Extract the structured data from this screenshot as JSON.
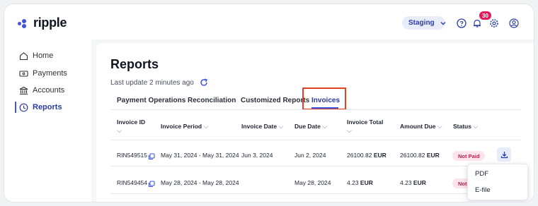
{
  "brand": {
    "name": "ripple",
    "accent": "#3f55e0"
  },
  "header": {
    "environment": "Staging",
    "notifications_count": "30",
    "icons": [
      "help-circle-icon",
      "bell-icon",
      "gear-icon",
      "user-icon"
    ]
  },
  "sidebar": {
    "items": [
      {
        "label": "Home",
        "icon": "home-icon"
      },
      {
        "label": "Payments",
        "icon": "payments-icon"
      },
      {
        "label": "Accounts",
        "icon": "bank-icon"
      },
      {
        "label": "Reports",
        "icon": "reports-icon",
        "active": true
      }
    ]
  },
  "page": {
    "title": "Reports",
    "last_update": "Last update 2 minutes ago"
  },
  "tabs": [
    {
      "label": "Payment Operations"
    },
    {
      "label": "Reconciliation"
    },
    {
      "label": "Customized Reports"
    },
    {
      "label": "Invoices",
      "active": true
    }
  ],
  "table": {
    "columns": [
      {
        "label": "Invoice ID"
      },
      {
        "label": "Invoice Period"
      },
      {
        "label": "Invoice Date"
      },
      {
        "label": "Due Date"
      },
      {
        "label": "Invoice Total"
      },
      {
        "label": "Amount Due"
      },
      {
        "label": "Status"
      }
    ],
    "sort_glyph": "⌵",
    "rows": [
      {
        "id": "RIN549515",
        "period": "May 31, 2024 - May 31, 2024",
        "invoice_date": "Jun 3, 2024",
        "due_date": "Jun 2, 2024",
        "total_amount": "26100.82",
        "total_currency": "EUR",
        "due_amount": "26100.82",
        "due_currency": "EUR",
        "status": "Not Paid"
      },
      {
        "id": "RIN549454",
        "period": "May 28, 2024 - May 28, 2024",
        "invoice_date": "",
        "due_date": "May 28, 2024",
        "total_amount": "4.23",
        "total_currency": "EUR",
        "due_amount": "4.23",
        "due_currency": "EUR",
        "status": "Not"
      }
    ]
  },
  "download_menu": {
    "options": [
      "PDF",
      "E-file"
    ]
  },
  "colors": {
    "status_bg": "#fde4ea",
    "status_text": "#c8174e",
    "highlight": "#e0421f",
    "badge": "#e4185e"
  }
}
